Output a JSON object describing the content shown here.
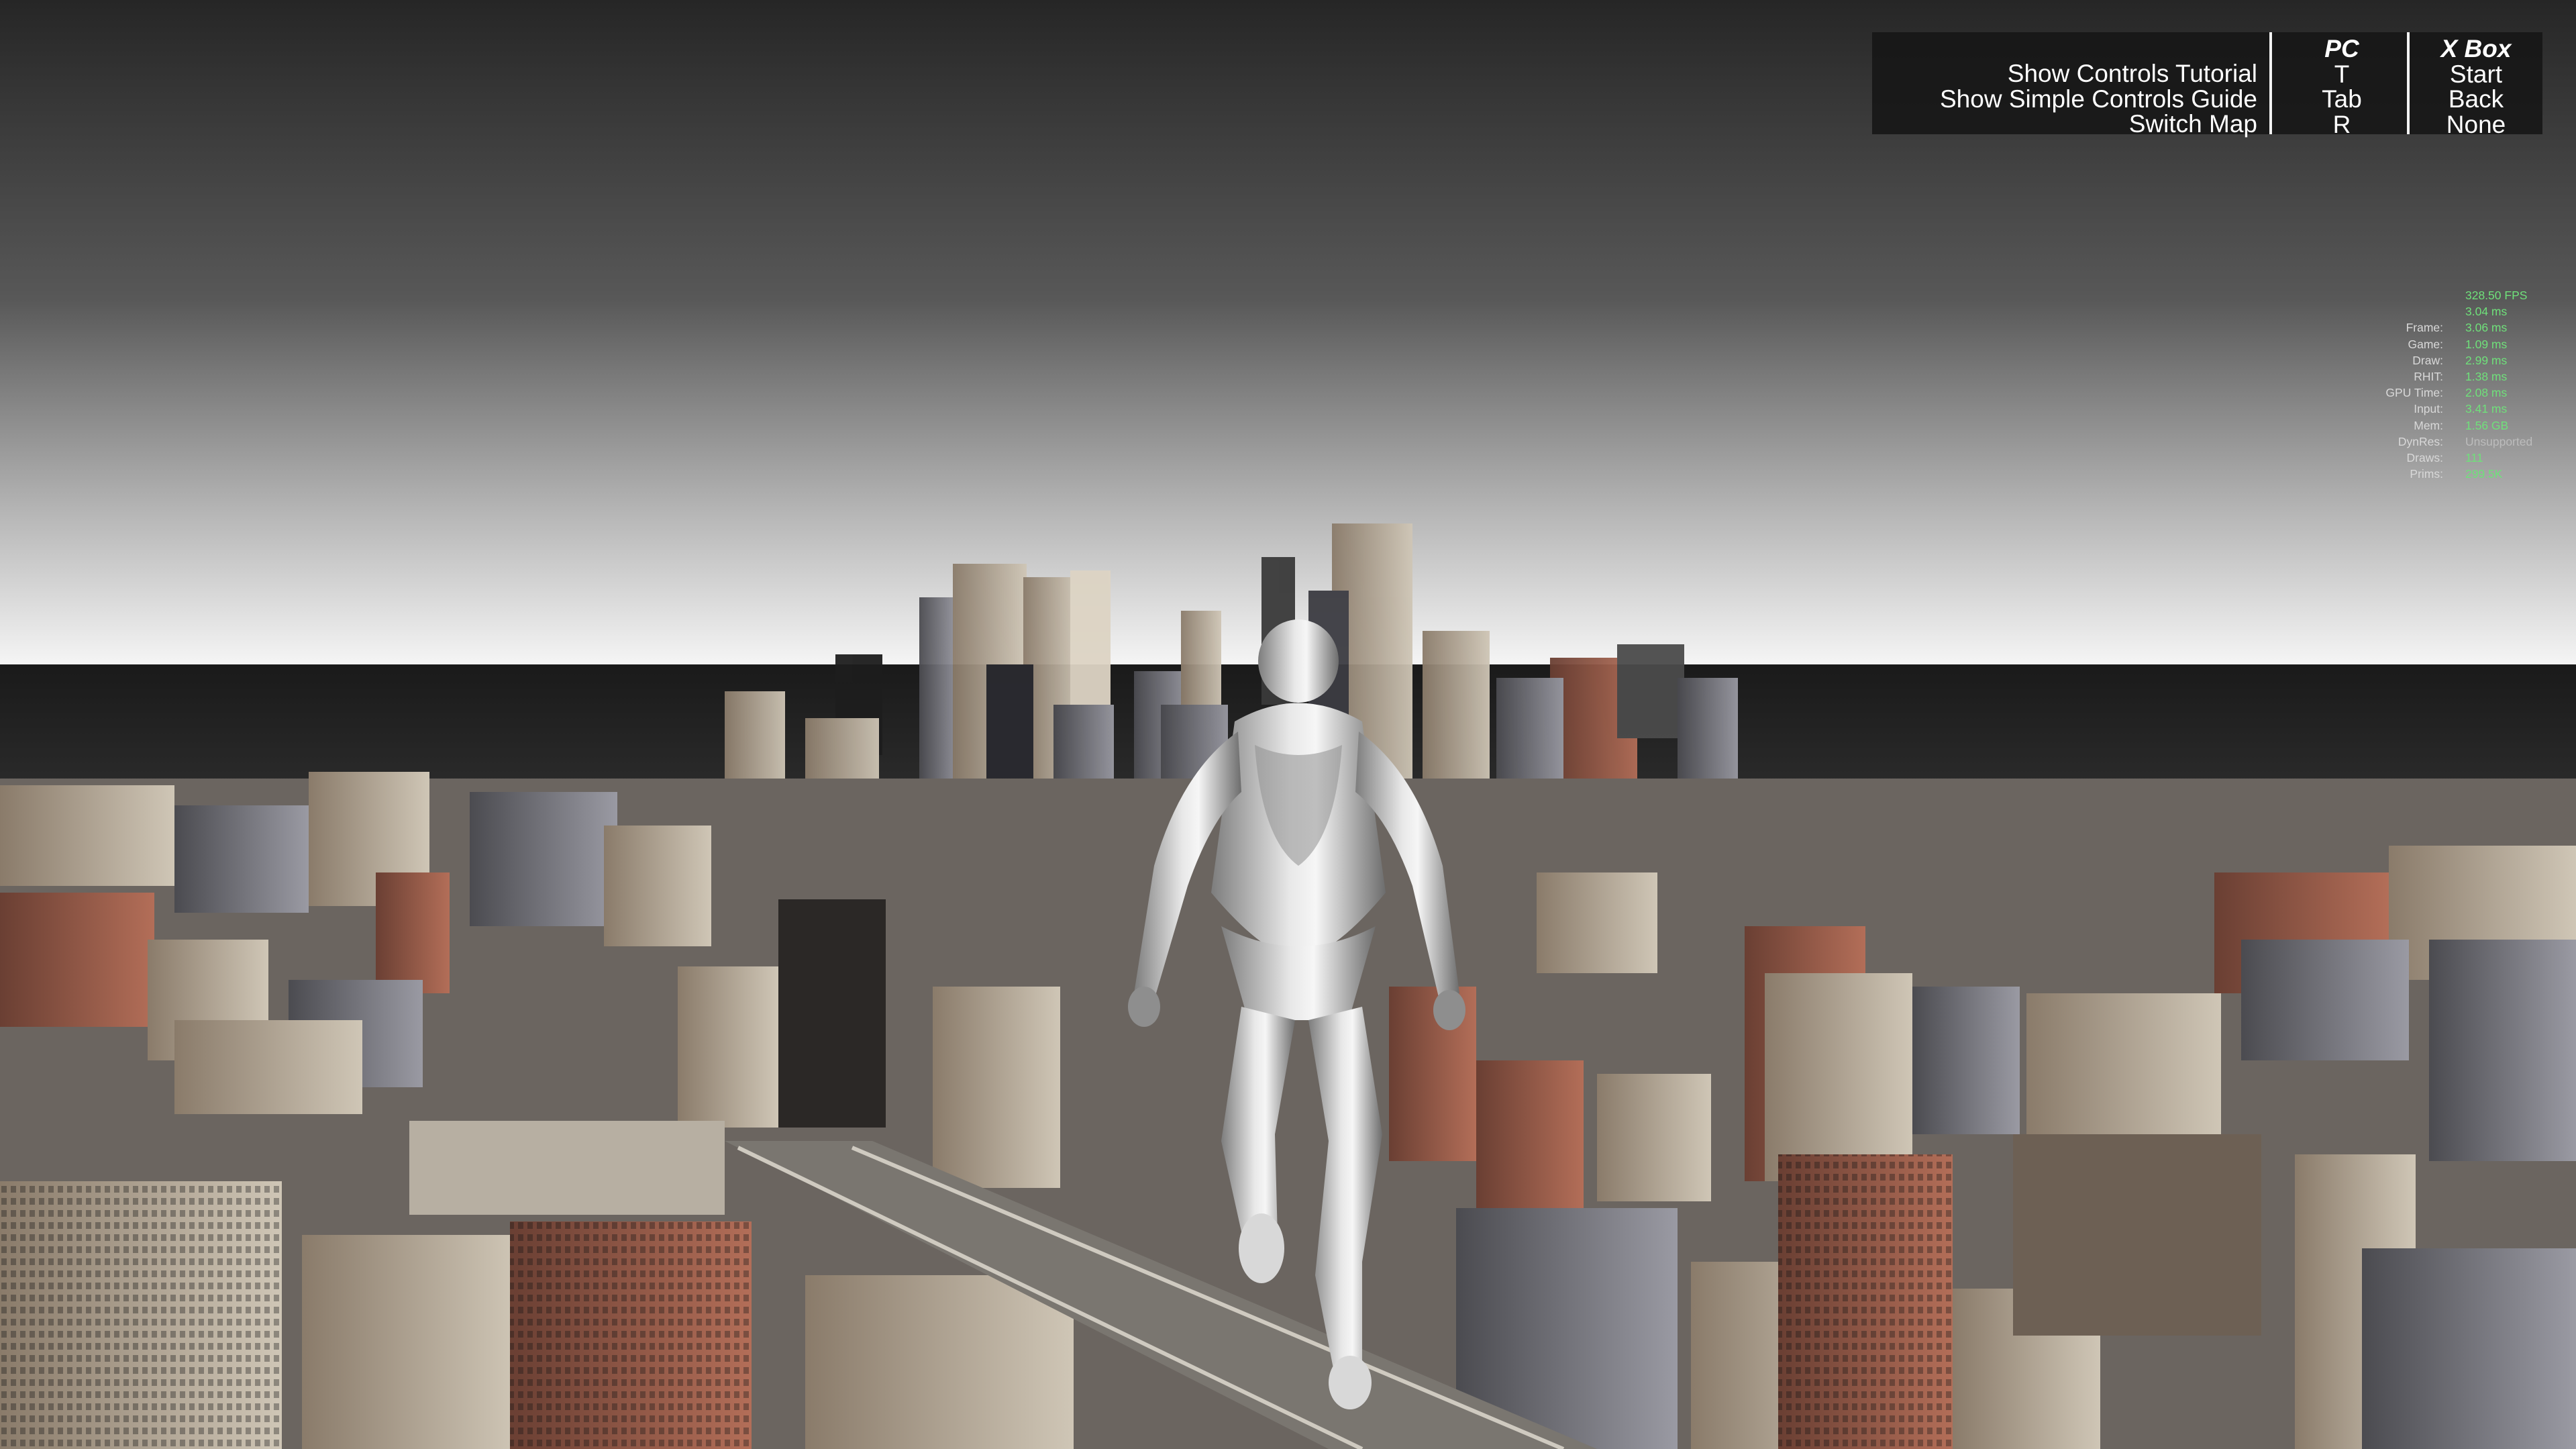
{
  "controls": {
    "actions": [
      "Show Controls Tutorial",
      "Show Simple Controls Guide",
      "Switch Map"
    ],
    "pc": {
      "header": "PC",
      "keys": [
        "T",
        "Tab",
        "R"
      ]
    },
    "xbox": {
      "header": "X Box",
      "keys": [
        "Start",
        "Back",
        "None"
      ]
    }
  },
  "stats": [
    {
      "label": "",
      "value": "328.50 FPS"
    },
    {
      "label": "",
      "value": "3.04 ms"
    },
    {
      "label": "Frame:",
      "value": "3.06 ms"
    },
    {
      "label": "Game:",
      "value": "1.09 ms"
    },
    {
      "label": "Draw:",
      "value": "2.99 ms"
    },
    {
      "label": "RHIT:",
      "value": "1.38 ms"
    },
    {
      "label": "GPU Time:",
      "value": "2.08 ms"
    },
    {
      "label": "Input:",
      "value": "3.41 ms"
    },
    {
      "label": "Mem:",
      "value": "1.56 GB"
    },
    {
      "label": "DynRes:",
      "value": "Unsupported"
    },
    {
      "label": "Draws:",
      "value": "111"
    },
    {
      "label": "Prims:",
      "value": "299.5K"
    }
  ],
  "colors": {
    "stat_value": "#6fe07a",
    "panel_bg": "#161616",
    "sky_top": "#2a2a2a",
    "horizon_glow": "#f4f4f4",
    "character": "#c9c9c9"
  }
}
